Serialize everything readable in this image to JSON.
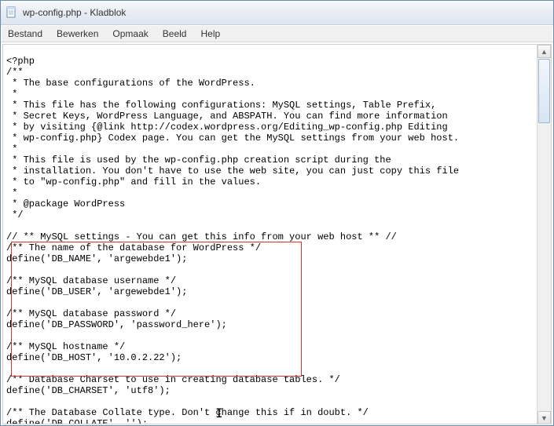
{
  "window": {
    "title": "wp-config.php - Kladblok"
  },
  "menu": {
    "file": "Bestand",
    "edit": "Bewerken",
    "format": "Opmaak",
    "view": "Beeld",
    "help": "Help"
  },
  "code": {
    "l01": "<?php",
    "l02": "/**",
    "l03": " * The base configurations of the WordPress.",
    "l04": " *",
    "l05": " * This file has the following configurations: MySQL settings, Table Prefix,",
    "l06": " * Secret Keys, WordPress Language, and ABSPATH. You can find more information",
    "l07": " * by visiting {@link http://codex.wordpress.org/Editing_wp-config.php Editing",
    "l08": " * wp-config.php} Codex page. You can get the MySQL settings from your web host.",
    "l09": " *",
    "l10": " * This file is used by the wp-config.php creation script during the",
    "l11": " * installation. You don't have to use the web site, you can just copy this file",
    "l12": " * to \"wp-config.php\" and fill in the values.",
    "l13": " *",
    "l14": " * @package WordPress",
    "l15": " */",
    "l16": "",
    "l17": "// ** MySQL settings - You can get this info from your web host ** //",
    "l18": "/** The name of the database for WordPress */",
    "l19": "define('DB_NAME', 'argewebde1');",
    "l20": "",
    "l21": "/** MySQL database username */",
    "l22": "define('DB_USER', 'argewebde1');",
    "l23": "",
    "l24": "/** MySQL database password */",
    "l25": "define('DB_PASSWORD', 'password_here');",
    "l26": "",
    "l27": "/** MySQL hostname */",
    "l28": "define('DB_HOST', '10.0.2.22');",
    "l29": "",
    "l30": "/** Database Charset to use in creating database tables. */",
    "l31": "define('DB_CHARSET', 'utf8');",
    "l32": "",
    "l33": "/** The Database Collate type. Don't change this if in doubt. */",
    "l34": "define('DB_COLLATE', '');"
  }
}
